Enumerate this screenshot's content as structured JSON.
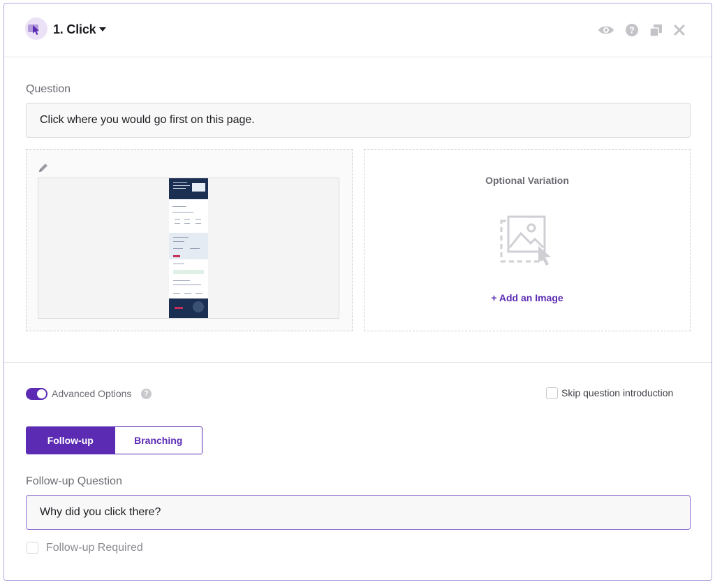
{
  "header": {
    "title": "1. Click",
    "type_icon": "click-cursor-icon",
    "actions": [
      {
        "name": "preview",
        "icon": "eye-icon"
      },
      {
        "name": "help",
        "icon": "help-circle-icon"
      },
      {
        "name": "duplicate",
        "icon": "copy-icon"
      },
      {
        "name": "delete",
        "icon": "close-icon"
      }
    ]
  },
  "question": {
    "label": "Question",
    "value": "Click where you would go first on this page."
  },
  "image_panel": {
    "edit_icon": "pencil-icon",
    "thumbnail": "webpage-screenshot-thumbnail"
  },
  "variation": {
    "title": "Optional Variation",
    "placeholder_icon": "image-placeholder-icon",
    "add_label": "+ Add an Image"
  },
  "advanced": {
    "toggle_on": true,
    "label": "Advanced Options",
    "help_glyph": "?",
    "skip_label": "Skip question introduction",
    "skip_checked": false
  },
  "tabs": [
    {
      "label": "Follow-up",
      "active": true
    },
    {
      "label": "Branching",
      "active": false
    }
  ],
  "followup": {
    "label": "Follow-up Question",
    "value": "Why did you click there?",
    "required_label": "Follow-up Required",
    "required_checked": false
  },
  "colors": {
    "accent": "#5b2bb3",
    "accent_light": "#ebe2f7",
    "muted_text": "#6b6b73",
    "border": "#d9d9de"
  }
}
